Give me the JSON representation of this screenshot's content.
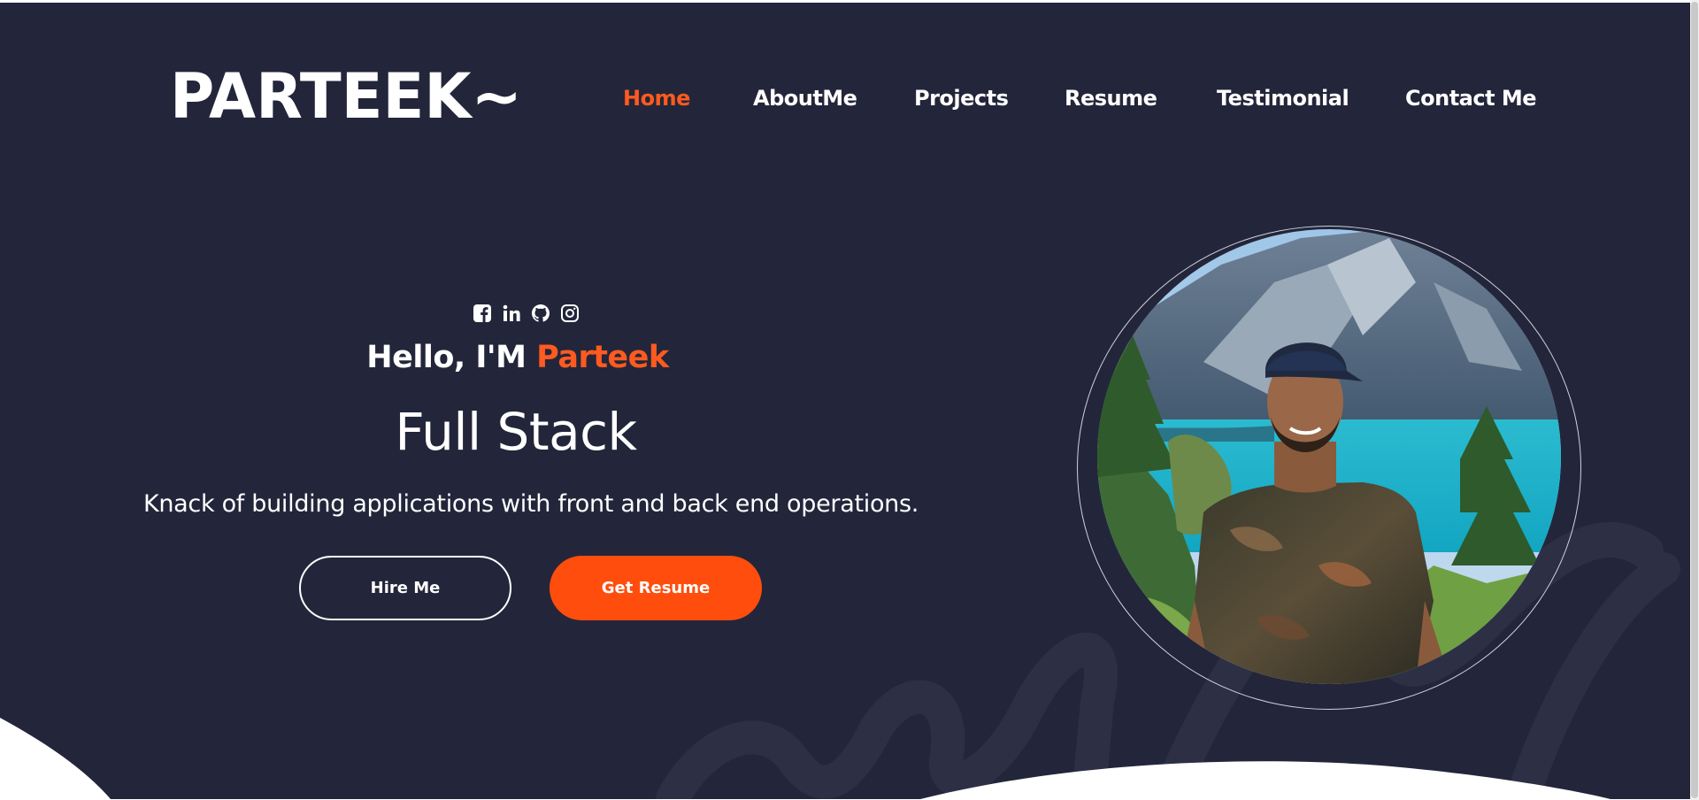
{
  "brand": {
    "logo_text": "PARTEEK~"
  },
  "nav": {
    "items": [
      {
        "label": "Home",
        "active": true
      },
      {
        "label": "AboutMe",
        "active": false
      },
      {
        "label": "Projects",
        "active": false
      },
      {
        "label": "Resume",
        "active": false
      },
      {
        "label": "Testimonial",
        "active": false
      },
      {
        "label": "Contact Me",
        "active": false
      }
    ]
  },
  "socials": [
    {
      "icon": "facebook-icon"
    },
    {
      "icon": "linkedin-icon"
    },
    {
      "icon": "github-icon"
    },
    {
      "icon": "instagram-icon"
    }
  ],
  "hero": {
    "greeting_prefix": "Hello, I'M ",
    "greeting_name": "Parteek",
    "role": "Full Stack",
    "tagline": "Knack of building applications with front and back end operations.",
    "buttons": {
      "hire": "Hire Me",
      "resume": "Get Resume"
    }
  },
  "colors": {
    "background": "#23263a",
    "accent": "#ff5a1f",
    "text": "#ffffff"
  }
}
